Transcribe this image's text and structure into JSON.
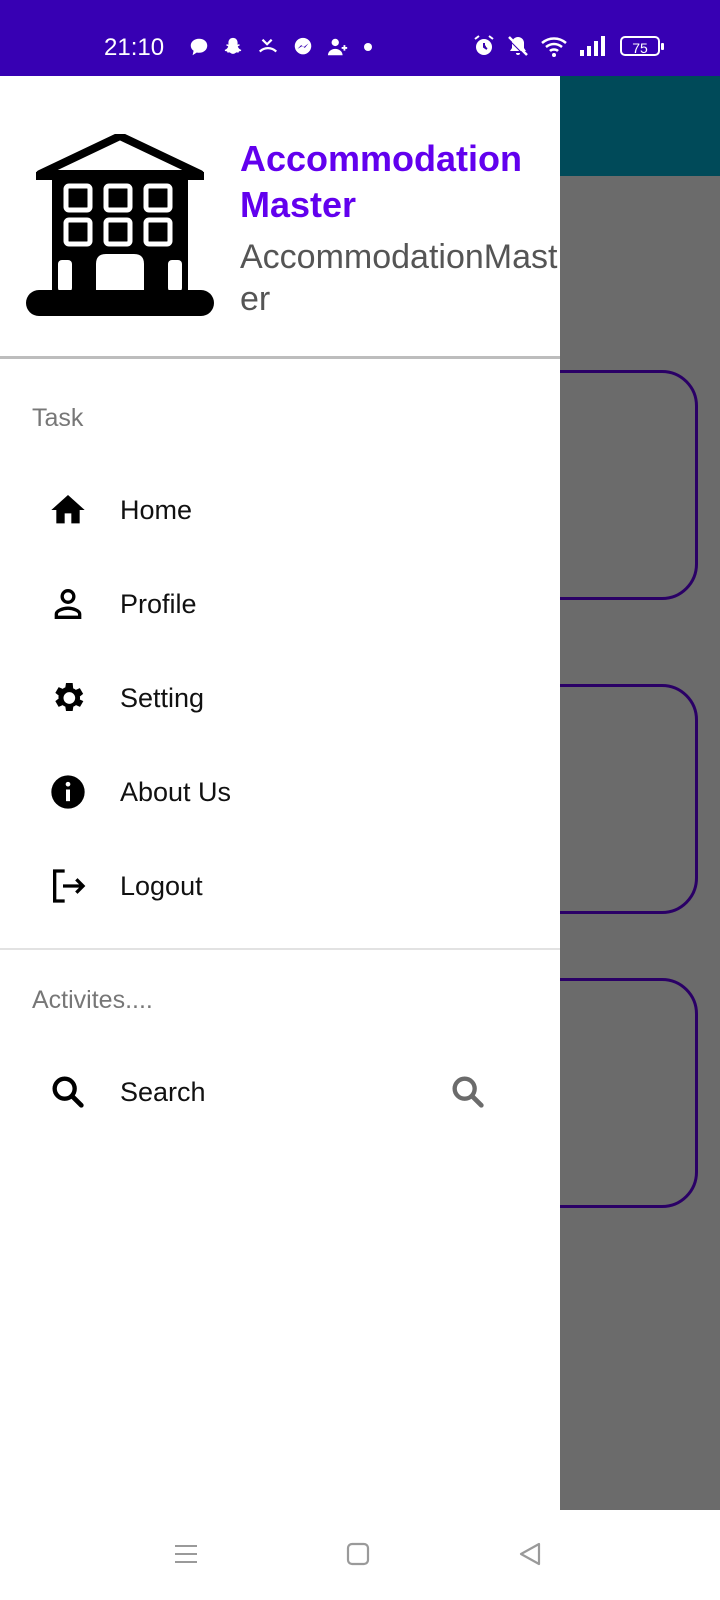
{
  "status_bar": {
    "time": "21:10",
    "battery": "75",
    "bg_color": "#3700b3",
    "left_icons": [
      "chat-icon",
      "snapchat-icon",
      "missed-call-icon",
      "messenger-icon",
      "add-person-icon",
      "dot-icon"
    ],
    "right_icons": [
      "alarm-icon",
      "mute-icon",
      "wifi-icon",
      "signal-icon",
      "battery-icon"
    ]
  },
  "drawer": {
    "header": {
      "title": "Accommodation Master",
      "subtitle": "AccommodationMaster",
      "title_color": "#6200ee",
      "logo_icon": "building-icon"
    },
    "section_task": "Task",
    "items": [
      {
        "label": "Home",
        "icon": "home-icon"
      },
      {
        "label": "Profile",
        "icon": "person-icon"
      },
      {
        "label": "Setting",
        "icon": "gear-icon"
      },
      {
        "label": "About Us",
        "icon": "info-icon"
      },
      {
        "label": "Logout",
        "icon": "logout-icon"
      }
    ],
    "section_activities": "Activites....",
    "activities": [
      {
        "label": "Search",
        "icon": "search-icon",
        "action_icon": "search-icon"
      }
    ]
  },
  "background_app": {
    "toolbar_color": "#004a59",
    "card_border_color": "#2a0066"
  },
  "nav_bar": {
    "buttons": [
      "menu-icon",
      "home-square-icon",
      "back-icon"
    ]
  }
}
